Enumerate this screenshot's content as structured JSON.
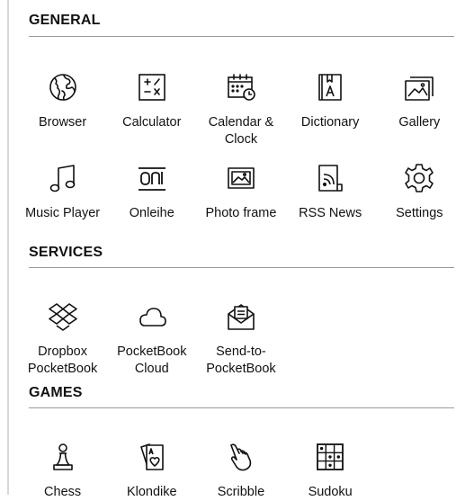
{
  "sections": [
    {
      "title": "GENERAL",
      "rows": [
        [
          {
            "label": "Browser",
            "icon": "globe-icon"
          },
          {
            "label": "Calculator",
            "icon": "calculator-icon"
          },
          {
            "label": "Calendar &\nClock",
            "icon": "calendar-clock-icon"
          },
          {
            "label": "Dictionary",
            "icon": "dictionary-icon"
          },
          {
            "label": "Gallery",
            "icon": "gallery-icon"
          }
        ],
        [
          {
            "label": "Music Player",
            "icon": "music-note-icon"
          },
          {
            "label": "Onleihe",
            "icon": "onleihe-icon"
          },
          {
            "label": "Photo frame",
            "icon": "photo-frame-icon"
          },
          {
            "label": "RSS News",
            "icon": "rss-icon"
          },
          {
            "label": "Settings",
            "icon": "gear-icon"
          }
        ]
      ]
    },
    {
      "title": "SERVICES",
      "rows": [
        [
          {
            "label": "Dropbox\nPocketBook",
            "icon": "dropbox-icon"
          },
          {
            "label": "PocketBook\nCloud",
            "icon": "cloud-icon"
          },
          {
            "label": "Send-to-\nPocketBook",
            "icon": "envelope-icon"
          }
        ]
      ]
    },
    {
      "title": "GAMES",
      "rows": [
        [
          {
            "label": "Chess",
            "icon": "chess-pawn-icon"
          },
          {
            "label": "Klondike",
            "icon": "playing-cards-icon"
          },
          {
            "label": "Scribble",
            "icon": "hand-pointer-icon"
          },
          {
            "label": "Sudoku",
            "icon": "sudoku-grid-icon"
          }
        ]
      ]
    }
  ]
}
